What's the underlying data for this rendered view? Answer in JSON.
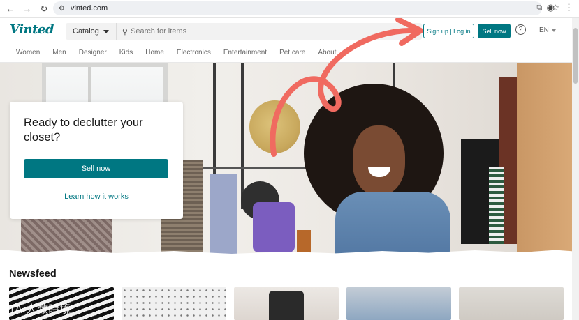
{
  "browser": {
    "url": "vinted.com",
    "icons": [
      "back-icon",
      "forward-icon",
      "reload-icon",
      "tune-icon",
      "translate-icon",
      "star-icon",
      "profile-icon",
      "menu-icon"
    ]
  },
  "header": {
    "logo": "Vinted",
    "catalog_label": "Catalog",
    "search_placeholder": "Search for items",
    "signup_label": "Sign up | Log in",
    "sell_label": "Sell now",
    "help_label": "?",
    "language": "EN"
  },
  "categories": [
    "Women",
    "Men",
    "Designer",
    "Kids",
    "Home",
    "Electronics",
    "Entertainment",
    "Pet care",
    "About"
  ],
  "hero": {
    "headline": "Ready to declutter your closet?",
    "cta_label": "Sell now",
    "learn_label": "Learn how it works",
    "arrow_color": "#f06a60"
  },
  "newsfeed": {
    "title": "Newsfeed"
  },
  "watermark": "ITA 人数時境",
  "colors": {
    "brand": "#007782"
  }
}
